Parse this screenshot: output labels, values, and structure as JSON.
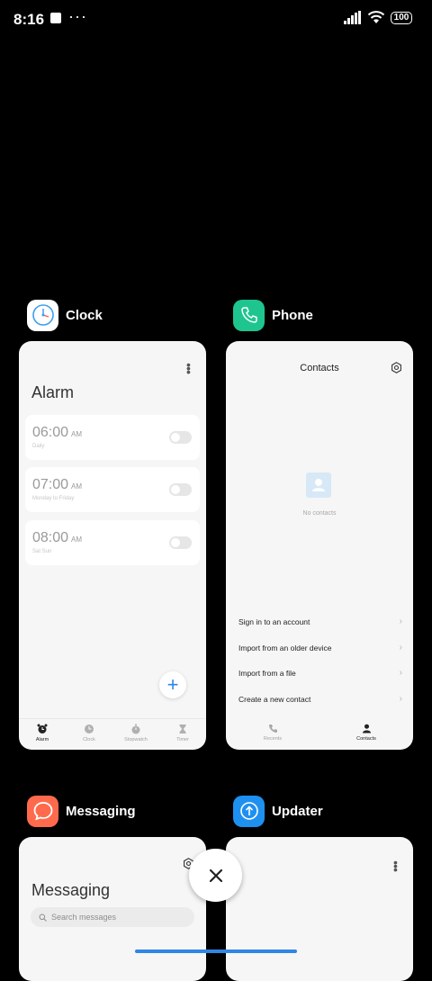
{
  "status_bar": {
    "time": "8:16",
    "dots": "···",
    "battery": "100"
  },
  "clock_app": {
    "name": "Clock",
    "screen_title": "Alarm",
    "alarms": [
      {
        "time": "06:00",
        "ampm": "AM",
        "repeat": "Daily"
      },
      {
        "time": "07:00",
        "ampm": "AM",
        "repeat": "Monday to Friday"
      },
      {
        "time": "08:00",
        "ampm": "AM",
        "repeat": "Sat Sun"
      }
    ],
    "add_label": "+",
    "tabs": [
      {
        "label": "Alarm",
        "icon": "alarm-icon",
        "active": true
      },
      {
        "label": "Clock",
        "icon": "clock-icon",
        "active": false
      },
      {
        "label": "Stopwatch",
        "icon": "stopwatch-icon",
        "active": false
      },
      {
        "label": "Timer",
        "icon": "timer-icon",
        "active": false
      }
    ]
  },
  "phone_app": {
    "name": "Phone",
    "screen_title": "Contacts",
    "empty_text": "No contacts",
    "options": [
      {
        "label": "Sign in to an account"
      },
      {
        "label": "Import from an older device"
      },
      {
        "label": "Import from a file"
      },
      {
        "label": "Create a new contact"
      }
    ],
    "chevron": "›",
    "tabs": [
      {
        "label": "Recents",
        "icon": "phone-icon",
        "active": false
      },
      {
        "label": "Contacts",
        "icon": "person-icon",
        "active": true
      }
    ]
  },
  "messaging_app": {
    "name": "Messaging",
    "screen_title": "Messaging",
    "search_placeholder": "Search messages"
  },
  "updater_app": {
    "name": "Updater"
  },
  "colors": {
    "phone_icon_bg": "#1fc58f",
    "messaging_icon_bg": "#ff6a4d",
    "updater_icon_bg": "#1e90f0",
    "accent": "#2f86e4"
  }
}
